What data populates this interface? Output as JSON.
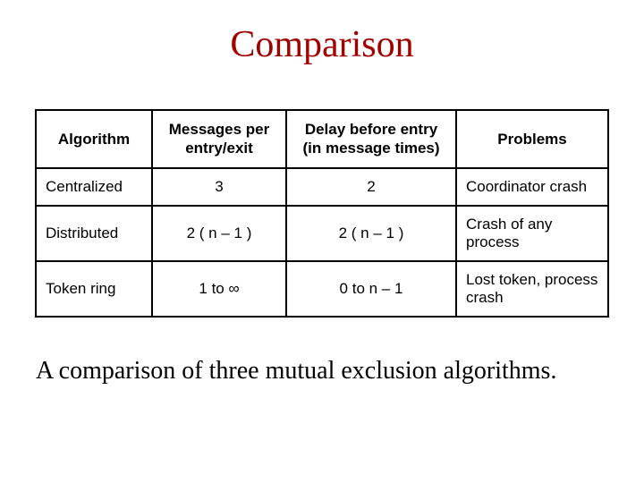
{
  "title": "Comparison",
  "table": {
    "headers": {
      "algorithm": "Algorithm",
      "messages": "Messages per entry/exit",
      "delay": "Delay before entry (in message times)",
      "problems": "Problems"
    },
    "rows": [
      {
        "algorithm": "Centralized",
        "messages": "3",
        "delay": "2",
        "problems": "Coordinator crash"
      },
      {
        "algorithm": "Distributed",
        "messages": "2 ( n – 1 )",
        "delay": "2 ( n – 1 )",
        "problems": "Crash of any process"
      },
      {
        "algorithm": "Token ring",
        "messages": "1 to ∞",
        "delay": "0 to n – 1",
        "problems": "Lost token, process crash"
      }
    ]
  },
  "caption": "A comparison of three mutual exclusion algorithms.",
  "chart_data": {
    "type": "table",
    "title": "Comparison",
    "columns": [
      "Algorithm",
      "Messages per entry/exit",
      "Delay before entry (in message times)",
      "Problems"
    ],
    "rows": [
      [
        "Centralized",
        "3",
        "2",
        "Coordinator crash"
      ],
      [
        "Distributed",
        "2 ( n – 1 )",
        "2 ( n – 1 )",
        "Crash of any process"
      ],
      [
        "Token ring",
        "1 to ∞",
        "0 to n – 1",
        "Lost token, process crash"
      ]
    ]
  }
}
